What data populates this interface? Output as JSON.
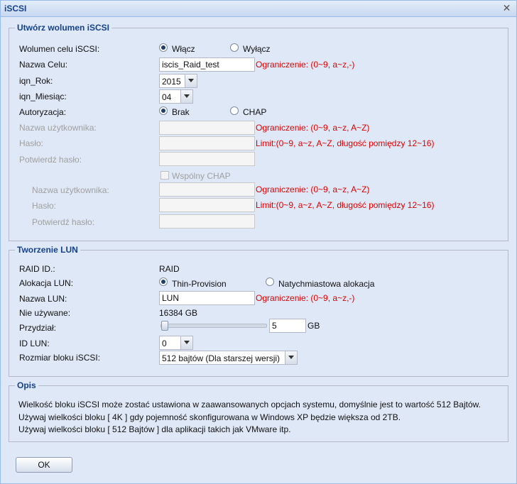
{
  "window": {
    "title": "iSCSI",
    "close_glyph": "✕"
  },
  "target_section": {
    "legend": "Utwórz wolumen iSCSI",
    "target_volume": {
      "label": "Wolumen celu iSCSI:",
      "on_label": "Włącz",
      "off_label": "Wyłącz",
      "selected": "on"
    },
    "target_name": {
      "label": "Nazwa Celu:",
      "value": "iscis_Raid_test",
      "hint": "Ograniczenie: (0~9, a~z,-)"
    },
    "iqn_year": {
      "label": "iqn_Rok:",
      "value": "2015"
    },
    "iqn_month": {
      "label": "iqn_Miesiąc:",
      "value": "04"
    },
    "auth": {
      "label": "Autoryzacja:",
      "none_label": "Brak",
      "chap_label": "CHAP",
      "selected": "none"
    },
    "username": {
      "label": "Nazwa użytkownika:",
      "value": "",
      "hint": "Ograniczenie: (0~9, a~z, A~Z)"
    },
    "password": {
      "label": "Hasło:",
      "value": "",
      "hint": "Limit:(0~9, a~z, A~Z, długość pomiędzy 12~16)"
    },
    "confirm_password": {
      "label": "Potwierdź hasło:",
      "value": ""
    },
    "mutual_chap": {
      "label": "Wspólny CHAP"
    },
    "mutual_username": {
      "label": "Nazwa użytkownika:",
      "value": "",
      "hint": "Ograniczenie: (0~9, a~z, A~Z)"
    },
    "mutual_password": {
      "label": "Hasło:",
      "value": "",
      "hint": "Limit:(0~9, a~z, A~Z, długość pomiędzy 12~16)"
    },
    "mutual_confirm_password": {
      "label": "Potwierdź hasło:",
      "value": ""
    }
  },
  "lun_section": {
    "legend": "Tworzenie LUN",
    "raid_id": {
      "label": "RAID ID.:",
      "value": "RAID"
    },
    "allocation": {
      "label": "Alokacja LUN:",
      "thin_label": "Thin-Provision",
      "instant_label": "Natychmiastowa alokacja",
      "selected": "thin"
    },
    "lun_name": {
      "label": "Nazwa LUN:",
      "value": "LUN",
      "hint": "Ograniczenie: (0~9, a~z,-)"
    },
    "unused": {
      "label": "Nie używane:",
      "value": "16384 GB"
    },
    "allocation_size": {
      "label": "Przydział:",
      "value": "5",
      "unit": "GB",
      "slider_fraction": 0.0
    },
    "lun_id": {
      "label": "ID LUN:",
      "value": "0"
    },
    "block_size": {
      "label": "Rozmiar bloku iSCSI:",
      "value": "512 bajtów (Dla starszej wersji)"
    }
  },
  "description_section": {
    "legend": "Opis",
    "lines": [
      "Wielkość bloku iSCSI może zostać ustawiona w zaawansowanych opcjach systemu, domyślnie jest to wartość 512 Bajtów.",
      "Używaj wielkości bloku [ 4K ] gdy pojemność skonfigurowana w Windows XP będzie większa od 2TB.",
      "Używaj wielkości bloku [ 512 Bajtów ] dla aplikacji takich jak VMware itp."
    ]
  },
  "footer": {
    "ok_label": "OK"
  },
  "colors": {
    "hint_red": "#e00000",
    "legend_blue": "#15428b",
    "window_bg": "#dfe8f6"
  }
}
